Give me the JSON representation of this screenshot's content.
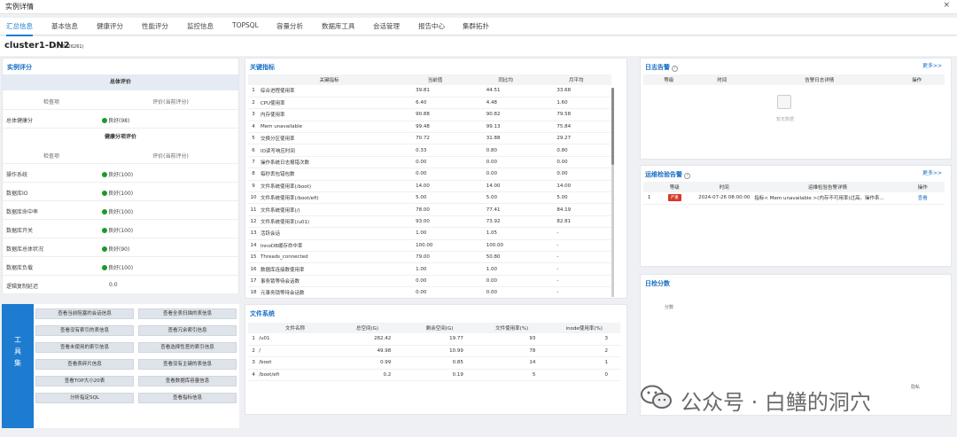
{
  "window": {
    "title": "实例详情",
    "close": "×"
  },
  "tabs": [
    "汇总信息",
    "基本信息",
    "健康评分",
    "性能评分",
    "监控信息",
    "TOPSQL",
    "容量分析",
    "数据库工具",
    "会话管理",
    "报告中心",
    "集群拓扑"
  ],
  "header": {
    "name": "cluster1-DN2",
    "sub": "(210326261)"
  },
  "score": {
    "title": "实例评分",
    "overall_head": "总体评价",
    "col_item": "检查项",
    "col_eval": "评价(当前评分)",
    "overall": {
      "item": "总体健康分",
      "value": "良好(98)"
    },
    "split_head": "健康分项评价",
    "rows": [
      {
        "item": "操作系统",
        "value": "良好(100)",
        "dot": true
      },
      {
        "item": "数据库IO",
        "value": "良好(100)",
        "dot": true
      },
      {
        "item": "数据库命中率",
        "value": "良好(100)",
        "dot": true
      },
      {
        "item": "数据库开关",
        "value": "良好(100)",
        "dot": true
      },
      {
        "item": "数据库总体状况",
        "value": "良好(90)",
        "dot": true
      },
      {
        "item": "数据库负载",
        "value": "良好(100)",
        "dot": true
      },
      {
        "item": "逻辑复制延迟",
        "value": "0.0",
        "dot": false
      }
    ]
  },
  "tools": {
    "side_label": "工具集",
    "buttons": [
      "查看当前阻塞的会话信息",
      "查看全表扫描的表信息",
      "查看没有索引的表信息",
      "查看冗余索引信息",
      "查看未使用的索引信息",
      "查看选择性差的索引信息",
      "查看表碎片信息",
      "查看没有主键的表信息",
      "查看TOP大小20表",
      "查看数据库容量信息",
      "分析指定SQL",
      "查看指标信息"
    ]
  },
  "kpi": {
    "title": "关键指标",
    "headers": [
      "关键指标",
      "当前值",
      "同比均",
      "月平均"
    ],
    "rows": [
      [
        "1",
        "综合进程使用率",
        "39.81",
        "44.51",
        "33.68"
      ],
      [
        "2",
        "CPU使用率",
        "6.40",
        "4.48",
        "1.60"
      ],
      [
        "3",
        "内存使用率",
        "90.88",
        "90.82",
        "79.58"
      ],
      [
        "4",
        "Mem unavailable",
        "99.48",
        "99.13",
        "75.84"
      ],
      [
        "5",
        "交换分区使用率",
        "70.72",
        "31.88",
        "29.27"
      ],
      [
        "6",
        "IO读写响应时间",
        "0.33",
        "0.80",
        "0.80"
      ],
      [
        "7",
        "操作系统日志报错次数",
        "0.00",
        "0.00",
        "0.00"
      ],
      [
        "8",
        "每秒丢包错包数",
        "0.00",
        "0.00",
        "0.00"
      ],
      [
        "9",
        "文件系统使用率(/boot)",
        "14.00",
        "14.00",
        "14.00"
      ],
      [
        "10",
        "文件系统使用率(/boot/efi)",
        "5.00",
        "5.00",
        "5.00"
      ],
      [
        "11",
        "文件系统使用率(/)",
        "78.00",
        "77.41",
        "84.19"
      ],
      [
        "12",
        "文件系统使用率(/u01)",
        "93.00",
        "73.92",
        "82.81"
      ],
      [
        "13",
        "活跃会话",
        "1.00",
        "1.05",
        "-"
      ],
      [
        "14",
        "InnoDB缓存命中率",
        "100.00",
        "100.00",
        "-"
      ],
      [
        "15",
        "Threads_connected",
        "79.00",
        "50.80",
        "-"
      ],
      [
        "16",
        "数据库连接数使用率",
        "1.00",
        "1.00",
        "-"
      ],
      [
        "17",
        "事务锁等待会话数",
        "0.00",
        "0.00",
        "-"
      ],
      [
        "18",
        "元事务锁等待会话数",
        "0.00",
        "0.00",
        "-"
      ]
    ]
  },
  "fs": {
    "title": "文件系统",
    "headers": [
      "文件名称",
      "总空间(G)",
      "剩余空间(G)",
      "文件使用率(%)",
      "inode使用率(%)"
    ],
    "rows": [
      [
        "1",
        "/u01",
        "282.42",
        "19.77",
        "93",
        "3"
      ],
      [
        "2",
        "/",
        "49.98",
        "10.99",
        "78",
        "2"
      ],
      [
        "3",
        "/boot",
        "0.99",
        "0.85",
        "14",
        "1"
      ],
      [
        "4",
        "/boot/efi",
        "0.2",
        "0.19",
        "5",
        "0"
      ]
    ]
  },
  "logalert": {
    "title": "日志告警",
    "help": "?",
    "more": "更多>>",
    "headers": [
      "等级",
      "时间",
      "告警日志详情",
      "操作"
    ],
    "empty": "暂无数据"
  },
  "opsalert": {
    "title": "运维检验告警",
    "help": "?",
    "more": "更多>>",
    "headers": [
      "等级",
      "时间",
      "运维检验告警详情",
      "操作"
    ],
    "row": {
      "no": "1",
      "level": "严重",
      "time": "2024-07-26 08:00:00",
      "detail": "指标< Mem unavailable >(内存不可用率)过高。操作系...",
      "action": "查看"
    }
  },
  "logscore": {
    "title": "日检分数",
    "label": "分数"
  },
  "watermark": {
    "text": "公众号 · 白鳝的洞穴",
    "small": "隐私"
  },
  "colors": {
    "accent": "#1a7bd6",
    "danger": "#d9362b",
    "ok": "#1a9a2a"
  }
}
